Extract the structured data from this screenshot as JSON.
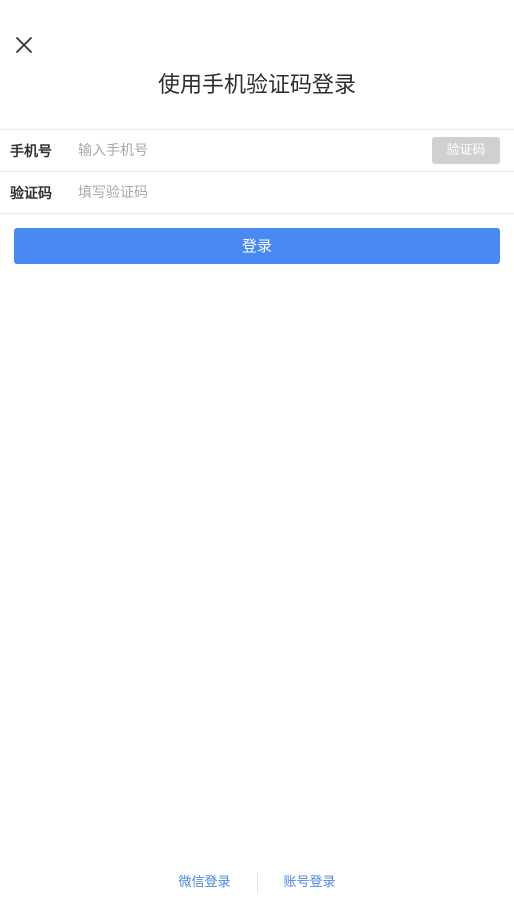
{
  "header": {
    "close_icon": "close-icon",
    "title": "使用手机验证码登录"
  },
  "form": {
    "phone": {
      "label": "手机号",
      "value": "",
      "placeholder": "输入手机号"
    },
    "code": {
      "label": "验证码",
      "value": "",
      "placeholder": "填写验证码"
    },
    "get_code_label": "验证码"
  },
  "actions": {
    "login_label": "登录"
  },
  "footer": {
    "wechat_login": "微信登录",
    "account_login": "账号登录"
  },
  "colors": {
    "primary": "#4889f4",
    "link": "#4a88e8",
    "disabled_button": "#d0d0d0",
    "divider": "#ececec"
  }
}
